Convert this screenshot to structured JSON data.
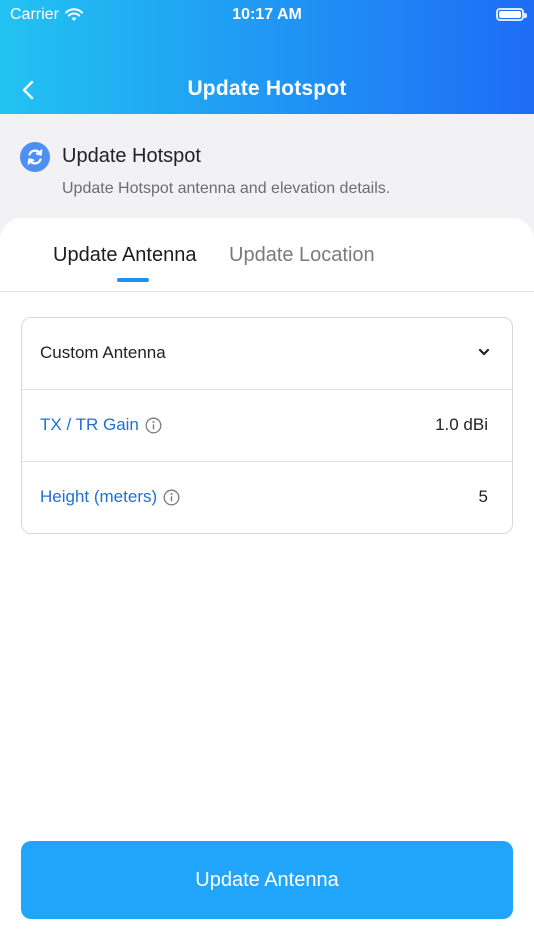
{
  "status_bar": {
    "carrier": "Carrier",
    "time": "10:17 AM"
  },
  "nav": {
    "title": "Update Hotspot",
    "back_icon": "chevron-left-icon"
  },
  "info": {
    "icon": "refresh-icon",
    "title": "Update Hotspot",
    "subtitle": "Update Hotspot antenna and elevation details."
  },
  "tabs": [
    {
      "label": "Update Antenna",
      "active": true
    },
    {
      "label": "Update Location",
      "active": false
    }
  ],
  "form": {
    "antenna_select": {
      "value": "Custom Antenna",
      "icon": "chevron-down-icon"
    },
    "gain": {
      "label": "TX / TR Gain",
      "value": "1.0 dBi",
      "icon": "info-icon"
    },
    "height": {
      "label": "Height (meters)",
      "value": "5",
      "icon": "info-icon"
    }
  },
  "primary_button": {
    "label": "Update Antenna"
  },
  "colors": {
    "accent": "#1f8ff4",
    "button": "#20a5fb",
    "link": "#1f6fd9"
  }
}
